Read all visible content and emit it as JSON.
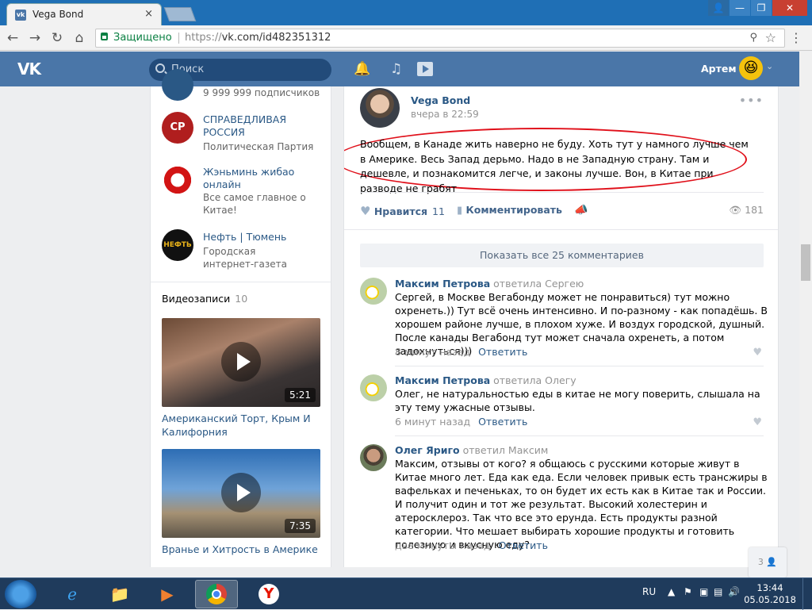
{
  "browser": {
    "tab_title": "Vega Bond",
    "tab_close": "×",
    "secure_label": "Защищено",
    "url_scheme": "https://",
    "url_rest": "vk.com/id482351312"
  },
  "vk": {
    "logo": "VK",
    "search_placeholder": "Поиск",
    "user_name": "Артем"
  },
  "groups": [
    {
      "name": "",
      "desc": "9 999 999 подписчиков"
    },
    {
      "name": "СПРАВЕДЛИВАЯ РОССИЯ",
      "desc": "Политическая Партия"
    },
    {
      "name": "Жэньминь жибао онлайн",
      "desc": "Все самое главное о Китае!"
    },
    {
      "name": "Нефть | Тюмень",
      "desc": "Городская интернет-газета"
    }
  ],
  "videos": {
    "header": "Видеозаписи",
    "count": "10",
    "items": [
      {
        "duration": "5:21",
        "title": "Американский Торт, Крым И Калифорния"
      },
      {
        "duration": "7:35",
        "title": "Вранье и Хитрость в Америке"
      }
    ]
  },
  "post": {
    "author": "Vega Bond",
    "time": "вчера в 22:59",
    "text": "Вообщем, в Канаде жить наверно не буду. Хоть тут у намного лучше чем в Америке. Весь Запад дерьмо. Надо в не Западную страну. Там и дешевле, и познакомится легче, и законы лучше. Вон, в Китае при разводе не грабят",
    "like_label": "Нравится",
    "like_count": "11",
    "comment_label": "Комментировать",
    "views": "181",
    "show_all": "Показать все 25 комментариев"
  },
  "comments": [
    {
      "author": "Максим Петрова",
      "reply": "ответила Сергею",
      "text": "Сергей, в Москве Вегабонду может не понравиться) тут можно охренеть.)) Тут всё очень интенсивно. И по-разному - как попадёшь. В хорошем районе лучше, в плохом хуже. И воздух городской, душный. После канады Вегабонд тут может сначала охренеть, а потом задохнуться)))",
      "time": "8 минут назад",
      "reply_link": "Ответить"
    },
    {
      "author": "Максим Петрова",
      "reply": "ответила Олегу",
      "text": "Олег, не натуральностью еды в китае не могу поверить, слышала на эту тему ужасные отзывы.",
      "time": "6 минут назад",
      "reply_link": "Ответить"
    },
    {
      "author": "Олег Яриго",
      "reply": "ответил Максим",
      "text": "Максим, отзывы от кого? я общаюсь с русскими которые живут в Китае много лет. Еда как еда. Если человек привык есть трансжиры в вафельках и печеньках, то он будет их есть как в Китае так и России. И получит один и тот же результат. Высокий холестерин и атеросклероз. Так что все это ерунда. Есть продукты разной категории. Что мешает выбирать хорошие продукты и готовить полезную и вкусную еду?",
      "time": "две минуты назад",
      "reply_link": "Ответить"
    }
  ],
  "chat_badge": "3",
  "taskbar": {
    "lang": "RU",
    "time": "13:44",
    "date": "05.05.2018"
  },
  "colors": {
    "vk_blue": "#4a76a8",
    "link": "#2a5885",
    "red_highlight": "#e0101a"
  }
}
